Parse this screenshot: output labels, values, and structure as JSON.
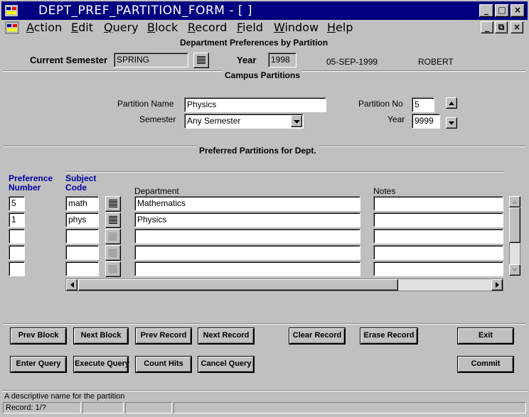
{
  "window": {
    "title": "DEPT_PREF_PARTITION_FORM - [ ]",
    "minimize_label": "_",
    "maximize_label": "□",
    "close_label": "×",
    "doc_minimize_label": "_",
    "doc_restore_label": "⧉",
    "doc_close_label": "×"
  },
  "menu": [
    {
      "label": "Action"
    },
    {
      "label": "Edit"
    },
    {
      "label": "Query"
    },
    {
      "label": "Block"
    },
    {
      "label": "Record"
    },
    {
      "label": "Field"
    },
    {
      "label": "Window"
    },
    {
      "label": "Help"
    }
  ],
  "header": {
    "form_title": "Department Preferences by Partition",
    "current_semester_label": "Current Semester",
    "current_semester_value": "SPRING",
    "year_label": "Year",
    "year_value": "1998",
    "date": "05-SEP-1999",
    "user": "ROBERT"
  },
  "campus": {
    "section_title": "Campus Partitions",
    "partition_name_label": "Partition Name",
    "partition_name_value": "Physics",
    "semester_label": "Semester",
    "semester_value": "Any Semester",
    "partition_no_label": "Partition No",
    "partition_no_value": "5",
    "year_label": "Year",
    "year_value": "9999"
  },
  "preferred": {
    "section_title": "Preferred Partitions for Dept.",
    "col_pref_line1": "Preference",
    "col_pref_line2": "Number",
    "col_subject_line1": "Subject",
    "col_subject_line2": "Code",
    "col_department": "Department",
    "col_notes": "Notes",
    "rows": [
      {
        "pref": "5",
        "subject": "math",
        "department": "Mathematics",
        "notes": ""
      },
      {
        "pref": "1",
        "subject": "phys",
        "department": "Physics",
        "notes": ""
      },
      {
        "pref": "",
        "subject": "",
        "department": "",
        "notes": ""
      },
      {
        "pref": "",
        "subject": "",
        "department": "",
        "notes": ""
      },
      {
        "pref": "",
        "subject": "",
        "department": "",
        "notes": ""
      }
    ]
  },
  "buttons": {
    "prev_block": "Prev Block",
    "next_block": "Next Block",
    "prev_record": "Prev Record",
    "next_record": "Next Record",
    "clear_record": "Clear Record",
    "erase_record": "Erase Record",
    "exit": "Exit",
    "enter_query": "Enter Query",
    "execute_query": "Execute Query",
    "count_hits": "Count Hits",
    "cancel_query": "Cancel Query",
    "commit": "Commit"
  },
  "status": {
    "hint": "A descriptive name for the partition",
    "record": "Record: 1/?"
  },
  "colors": {
    "titlebar": "#000080",
    "face": "#c0c0c0",
    "label_blue": "#0000a0"
  }
}
